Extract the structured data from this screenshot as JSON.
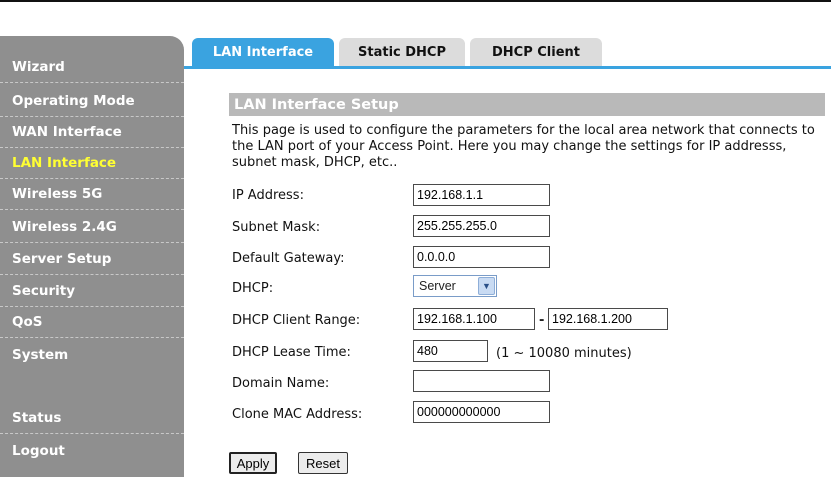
{
  "sidebar": {
    "items": [
      {
        "label": "Wizard",
        "active": false
      },
      {
        "label": "Operating Mode",
        "active": false
      },
      {
        "label": "WAN Interface",
        "active": false
      },
      {
        "label": "LAN Interface",
        "active": true
      },
      {
        "label": "Wireless 5G",
        "active": false
      },
      {
        "label": "Wireless 2.4G",
        "active": false
      },
      {
        "label": "Server Setup",
        "active": false
      },
      {
        "label": "Security",
        "active": false
      },
      {
        "label": "QoS",
        "active": false
      },
      {
        "label": "System",
        "active": false
      },
      {
        "label": "Status",
        "active": false
      },
      {
        "label": "Logout",
        "active": false
      }
    ]
  },
  "tabs": [
    {
      "label": "LAN Interface",
      "active": true
    },
    {
      "label": "Static DHCP",
      "active": false
    },
    {
      "label": "DHCP Client",
      "active": false
    }
  ],
  "main": {
    "title": "LAN Interface Setup",
    "description": "This page is used to configure the parameters for the local area network that connects to the LAN port of your Access Point. Here you may change the settings for IP addresss, subnet mask, DHCP, etc..",
    "fields": {
      "ip_address": {
        "label": "IP Address:",
        "value": "192.168.1.1"
      },
      "subnet_mask": {
        "label": "Subnet Mask:",
        "value": "255.255.255.0"
      },
      "default_gateway": {
        "label": "Default Gateway:",
        "value": "0.0.0.0"
      },
      "dhcp": {
        "label": "DHCP:",
        "value": "Server"
      },
      "dhcp_client_range": {
        "label": "DHCP Client Range:",
        "start": "192.168.1.100",
        "separator": "-",
        "end": "192.168.1.200"
      },
      "dhcp_lease_time": {
        "label": "DHCP Lease Time:",
        "value": "480",
        "note": "(1 ~ 10080 minutes)"
      },
      "domain_name": {
        "label": "Domain Name:",
        "value": ""
      },
      "clone_mac": {
        "label": "Clone MAC Address:",
        "value": "000000000000"
      }
    },
    "buttons": {
      "apply": "Apply",
      "reset": "Reset"
    }
  },
  "colors": {
    "sidebar_bg": "#8f8f8f",
    "sidebar_active": "#ffff33",
    "tab_active": "#3aa3e0",
    "tab_inactive": "#dcdcdc",
    "section_head": "#b9b9b9"
  }
}
